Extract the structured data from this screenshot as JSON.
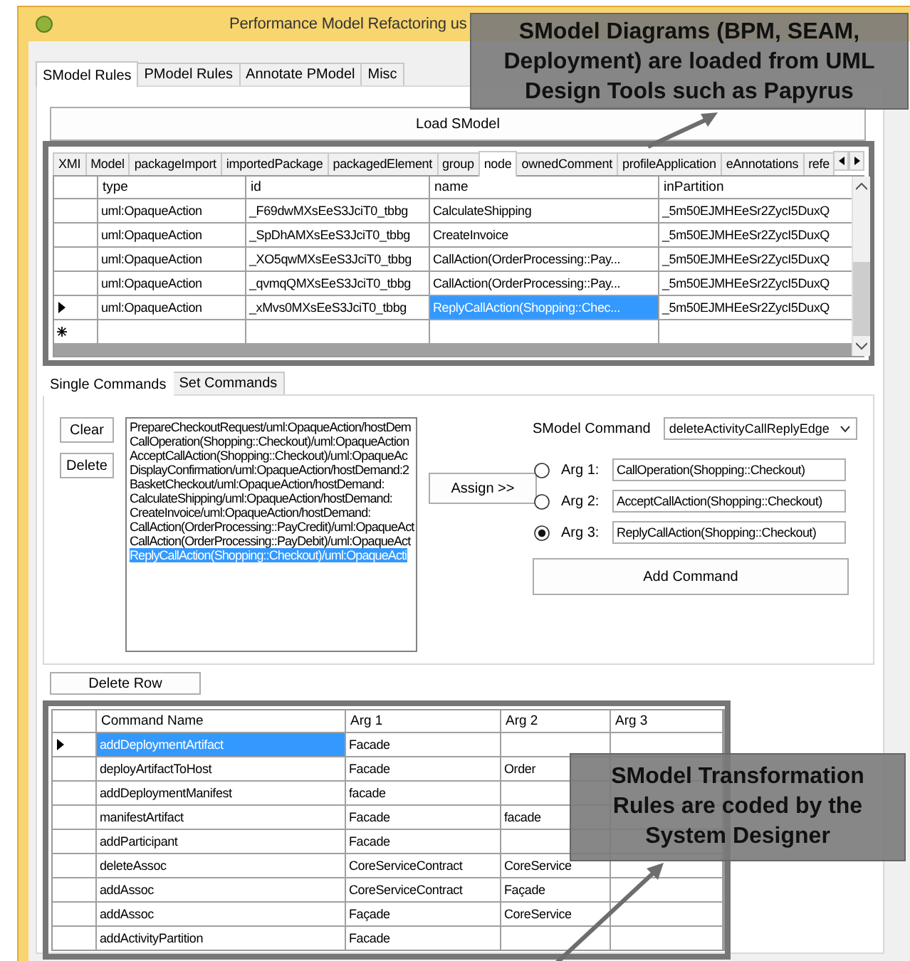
{
  "window": {
    "title": "Performance Model Refactoring us"
  },
  "main_tabs": [
    {
      "label": "SModel Rules",
      "selected": true
    },
    {
      "label": "PModel Rules",
      "selected": false
    },
    {
      "label": "Annotate PModel",
      "selected": false
    },
    {
      "label": "Misc",
      "selected": false
    }
  ],
  "load_button": "Load SModel",
  "xmi_tabs": [
    {
      "label": "XMI",
      "selected": false
    },
    {
      "label": "Model",
      "selected": false
    },
    {
      "label": "packageImport",
      "selected": false
    },
    {
      "label": "importedPackage",
      "selected": false
    },
    {
      "label": "packagedElement",
      "selected": false
    },
    {
      "label": "group",
      "selected": false
    },
    {
      "label": "node",
      "selected": true
    },
    {
      "label": "ownedComment",
      "selected": false
    },
    {
      "label": "profileApplication",
      "selected": false
    },
    {
      "label": "eAnnotations",
      "selected": false
    },
    {
      "label": "refe",
      "selected": false
    }
  ],
  "node_grid": {
    "columns": [
      "type",
      "id",
      "name",
      "inPartition"
    ],
    "new_row": true,
    "rows": [
      {
        "current": false,
        "cells": [
          {
            "text": "uml:OpaqueAction",
            "selected": false
          },
          {
            "text": "_F69dwMXsEeS3JciT0_tbbg",
            "selected": false
          },
          {
            "text": "CalculateShipping",
            "selected": false
          },
          {
            "text": "_5m50EJMHEeSr2ZycI5DuxQ",
            "selected": false
          }
        ]
      },
      {
        "current": false,
        "cells": [
          {
            "text": "uml:OpaqueAction",
            "selected": false
          },
          {
            "text": "_SpDhAMXsEeS3JciT0_tbbg",
            "selected": false
          },
          {
            "text": "CreateInvoice",
            "selected": false
          },
          {
            "text": "_5m50EJMHEeSr2ZycI5DuxQ",
            "selected": false
          }
        ]
      },
      {
        "current": false,
        "cells": [
          {
            "text": "uml:OpaqueAction",
            "selected": false
          },
          {
            "text": "_XO5qwMXsEeS3JciT0_tbbg",
            "selected": false
          },
          {
            "text": "CallAction(OrderProcessing::Pay...",
            "selected": false
          },
          {
            "text": "_5m50EJMHEeSr2ZycI5DuxQ",
            "selected": false
          }
        ]
      },
      {
        "current": false,
        "cells": [
          {
            "text": "uml:OpaqueAction",
            "selected": false
          },
          {
            "text": "_qvmqQMXsEeS3JciT0_tbbg",
            "selected": false
          },
          {
            "text": "CallAction(OrderProcessing::Pay...",
            "selected": false
          },
          {
            "text": "_5m50EJMHEeSr2ZycI5DuxQ",
            "selected": false
          }
        ]
      },
      {
        "current": true,
        "cells": [
          {
            "text": "uml:OpaqueAction",
            "selected": false
          },
          {
            "text": "_xMvs0MXsEeS3JciT0_tbbg",
            "selected": false
          },
          {
            "text": "ReplyCallAction(Shopping::Chec...",
            "selected": true
          },
          {
            "text": "_5m50EJMHEeSr2ZycI5DuxQ",
            "selected": false
          }
        ]
      }
    ]
  },
  "command_tabs": [
    {
      "label": "Single Commands",
      "selected": true
    },
    {
      "label": "Set Commands",
      "selected": false
    }
  ],
  "clear_button": "Clear",
  "delete_button": "Delete",
  "command_list": [
    {
      "text": "PrepareCheckoutRequest/uml:OpaqueAction/hostDem",
      "selected": false
    },
    {
      "text": "CallOperation(Shopping::Checkout)/uml:OpaqueAction",
      "selected": false
    },
    {
      "text": "AcceptCallAction(Shopping::Checkout)/uml:OpaqueAc",
      "selected": false
    },
    {
      "text": "DisplayConfirmation/uml:OpaqueAction/hostDemand:2",
      "selected": false
    },
    {
      "text": "BasketCheckout/uml:OpaqueAction/hostDemand:",
      "selected": false
    },
    {
      "text": "CalculateShipping/uml:OpaqueAction/hostDemand:",
      "selected": false
    },
    {
      "text": "CreateInvoice/uml:OpaqueAction/hostDemand:",
      "selected": false
    },
    {
      "text": "CallAction(OrderProcessing::PayCredit)/uml:OpaqueAct",
      "selected": false
    },
    {
      "text": "CallAction(OrderProcessing::PayDebit)/uml:OpaqueAct",
      "selected": false
    },
    {
      "text": "ReplyCallAction(Shopping::Checkout)/uml:OpaqueActi",
      "selected": true
    }
  ],
  "assign_button": "Assign >>",
  "smodel_command": {
    "label": "SModel Command",
    "value": "deleteActivityCallReplyEdge"
  },
  "args": [
    {
      "label": "Arg 1:",
      "value": "CallOperation(Shopping::Checkout)",
      "selected": false
    },
    {
      "label": "Arg 2:",
      "value": "AcceptCallAction(Shopping::Checkout)",
      "selected": false
    },
    {
      "label": "Arg 3:",
      "value": "ReplyCallAction(Shopping::Checkout)",
      "selected": true
    }
  ],
  "add_command_button": "Add Command",
  "delete_row_button": "Delete Row",
  "rules_grid": {
    "columns": [
      "Command Name",
      "Arg 1",
      "Arg 2",
      "Arg 3"
    ],
    "rows": [
      {
        "current": true,
        "cells": [
          {
            "text": "addDeploymentArtifact",
            "selected": true
          },
          {
            "text": "Facade",
            "selected": false
          },
          {
            "text": "",
            "selected": false
          },
          {
            "text": "",
            "selected": false
          }
        ]
      },
      {
        "current": false,
        "cells": [
          {
            "text": "deployArtifactToHost",
            "selected": false
          },
          {
            "text": "Facade",
            "selected": false
          },
          {
            "text": "Order",
            "selected": false
          },
          {
            "text": "",
            "selected": false
          }
        ]
      },
      {
        "current": false,
        "cells": [
          {
            "text": "addDeploymentManifest",
            "selected": false
          },
          {
            "text": "facade",
            "selected": false
          },
          {
            "text": "",
            "selected": false
          },
          {
            "text": "",
            "selected": false
          }
        ]
      },
      {
        "current": false,
        "cells": [
          {
            "text": "manifestArtifact",
            "selected": false
          },
          {
            "text": "Facade",
            "selected": false
          },
          {
            "text": "facade",
            "selected": false
          },
          {
            "text": "",
            "selected": false
          }
        ]
      },
      {
        "current": false,
        "cells": [
          {
            "text": "addParticipant",
            "selected": false
          },
          {
            "text": "Facade",
            "selected": false
          },
          {
            "text": "",
            "selected": false
          },
          {
            "text": "",
            "selected": false
          }
        ]
      },
      {
        "current": false,
        "cells": [
          {
            "text": "deleteAssoc",
            "selected": false
          },
          {
            "text": "CoreServiceContract",
            "selected": false
          },
          {
            "text": "CoreService",
            "selected": false
          },
          {
            "text": "",
            "selected": false
          }
        ]
      },
      {
        "current": false,
        "cells": [
          {
            "text": "addAssoc",
            "selected": false
          },
          {
            "text": "CoreServiceContract",
            "selected": false
          },
          {
            "text": "Façade",
            "selected": false
          },
          {
            "text": "",
            "selected": false
          }
        ]
      },
      {
        "current": false,
        "cells": [
          {
            "text": "addAssoc",
            "selected": false
          },
          {
            "text": "Façade",
            "selected": false
          },
          {
            "text": "CoreService",
            "selected": false
          },
          {
            "text": "",
            "selected": false
          }
        ]
      },
      {
        "current": false,
        "cells": [
          {
            "text": "addActivityPartition",
            "selected": false
          },
          {
            "text": "Facade",
            "selected": false
          },
          {
            "text": "",
            "selected": false
          },
          {
            "text": "",
            "selected": false
          }
        ]
      }
    ]
  },
  "callouts": [
    {
      "kind": "top",
      "text": "SModel Diagrams (BPM, SEAM, Deployment) are loaded from UML Design Tools such as Papyrus"
    },
    {
      "kind": "bottom",
      "text": "SModel Transformation Rules are coded by the System Designer"
    }
  ]
}
